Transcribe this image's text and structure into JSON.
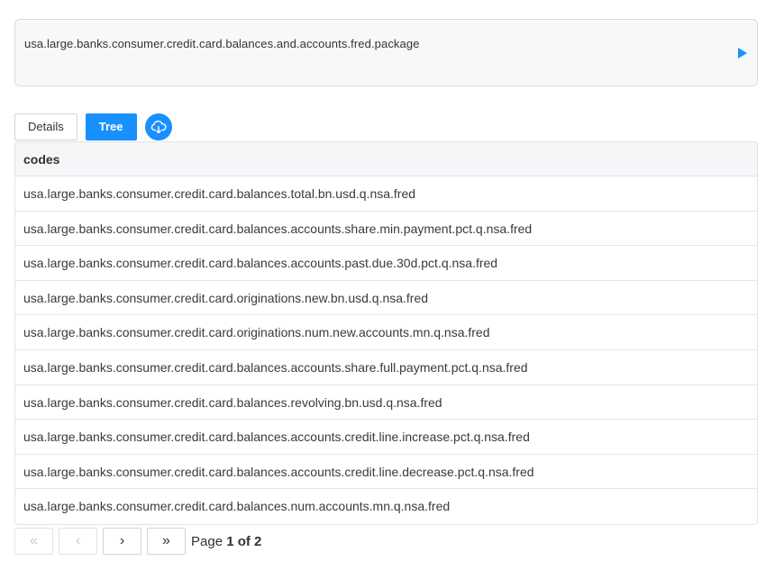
{
  "query": {
    "text": "usa.large.banks.consumer.credit.card.balances.and.accounts.fred.package"
  },
  "tabs": [
    {
      "label": "Details",
      "active": false
    },
    {
      "label": "Tree",
      "active": true
    }
  ],
  "icons": {
    "run": "play-icon",
    "download": "cloud-download-icon"
  },
  "table": {
    "header": "codes",
    "rows": [
      "usa.large.banks.consumer.credit.card.balances.total.bn.usd.q.nsa.fred",
      "usa.large.banks.consumer.credit.card.balances.accounts.share.min.payment.pct.q.nsa.fred",
      "usa.large.banks.consumer.credit.card.balances.accounts.past.due.30d.pct.q.nsa.fred",
      "usa.large.banks.consumer.credit.card.originations.new.bn.usd.q.nsa.fred",
      "usa.large.banks.consumer.credit.card.originations.num.new.accounts.mn.q.nsa.fred",
      "usa.large.banks.consumer.credit.card.balances.accounts.share.full.payment.pct.q.nsa.fred",
      "usa.large.banks.consumer.credit.card.balances.revolving.bn.usd.q.nsa.fred",
      "usa.large.banks.consumer.credit.card.balances.accounts.credit.line.increase.pct.q.nsa.fred",
      "usa.large.banks.consumer.credit.card.balances.accounts.credit.line.decrease.pct.q.nsa.fred",
      "usa.large.banks.consumer.credit.card.balances.num.accounts.mn.q.nsa.fred"
    ]
  },
  "pagination": {
    "first": "«",
    "prev": "‹",
    "next": "›",
    "last": "»",
    "page_prefix": "Page",
    "page_current": "1 of 2"
  },
  "colors": {
    "accent": "#1890ff",
    "border": "#d9dbe0",
    "header_bg": "#f5f6f8"
  }
}
